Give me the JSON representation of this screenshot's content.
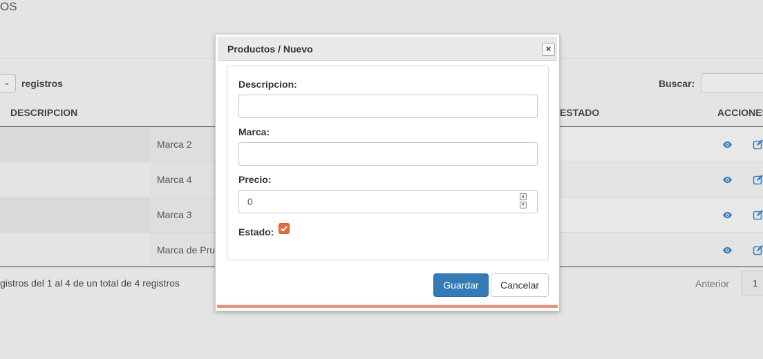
{
  "page": {
    "title_fragment": "OS",
    "length_suffix": "registros",
    "search_label": "Buscar:",
    "search_value": ""
  },
  "table": {
    "headers": [
      "DESCRIPCION",
      "ESTADO",
      "ACCIONES"
    ],
    "rows": [
      {
        "marca": "Marca 2"
      },
      {
        "marca": "Marca 4"
      },
      {
        "marca": "Marca 3"
      },
      {
        "marca": "Marca de Pru"
      }
    ],
    "info": "gistros del 1 al 4 de un total de 4 registros",
    "pagination": {
      "prev": "Anterior",
      "page": "1"
    }
  },
  "modal": {
    "title": "Productos / Nuevo",
    "close_symbol": "×",
    "fields": {
      "descripcion": {
        "label": "Descripcion:",
        "value": ""
      },
      "marca": {
        "label": "Marca:",
        "value": ""
      },
      "precio": {
        "label": "Precio:",
        "value": "0"
      },
      "estado": {
        "label": "Estado:",
        "checked": true
      }
    },
    "buttons": {
      "save": "Guardar",
      "cancel": "Cancelar"
    }
  },
  "colors": {
    "primary": "#337ab7",
    "accent": "#e06e3f",
    "icon_blue": "#3d82c4"
  },
  "icons": {
    "view": "eye-icon",
    "edit": "edit-icon",
    "close": "close-icon",
    "dropdown": "chevron-down-icon"
  }
}
